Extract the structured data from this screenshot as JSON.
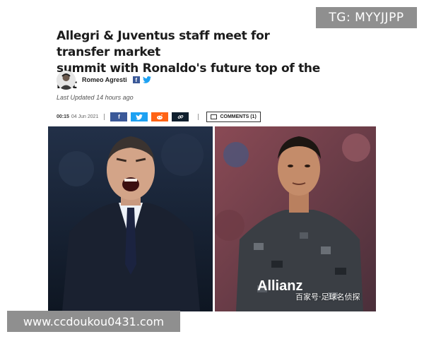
{
  "overlay": {
    "tg_badge": "TG: MYYJJPP",
    "url_banner": "www.ccdoukou0431.com",
    "watermark_cn": "百家号·足球名侦探"
  },
  "article": {
    "headline_line1": "Allegri & Juventus staff meet for transfer market",
    "headline_line2": "summit with Ronaldo's future top of the list",
    "author": "Romeo Agresti",
    "last_updated_label": "Last Updated",
    "last_updated_value": "14 hours ago",
    "time": "00:15",
    "date": "04 Jun 2021",
    "comments_label": "COMMENTS (1)"
  },
  "share": {
    "facebook_glyph": "f",
    "twitter_glyph": "t",
    "reddit_glyph": "r",
    "link_glyph": "🔗"
  },
  "images": {
    "left_alt": "Allegri shouting",
    "right_alt": "Ronaldo in Juventus kit",
    "jersey_sponsor": "Allianz"
  },
  "colors": {
    "facebook": "#3b5998",
    "twitter": "#1da1f2",
    "reddit": "#ff6314",
    "link": "#0f1f2e",
    "overlay_gray": "#8f8f8f"
  }
}
